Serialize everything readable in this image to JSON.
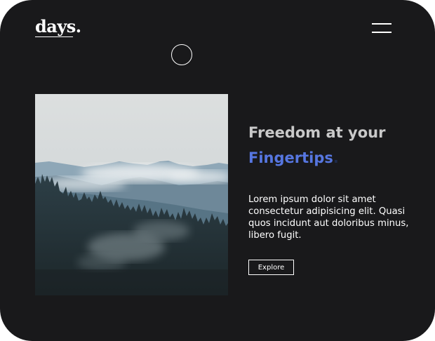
{
  "brand": {
    "logo_text": "days."
  },
  "header": {
    "menu_icon": "hamburger-menu-icon"
  },
  "hero": {
    "image_description_icon": "misty-mountain-forest-image",
    "headline_line1": "Freedom at your",
    "headline_accent": "Fingertips",
    "headline_accent_punct": ".",
    "body": "Lorem ipsum dolor sit amet consectetur adipisicing elit. Quasi quos incidunt aut doloribus minus, libero fugit.",
    "button_label": "Explore"
  },
  "colors": {
    "background": "#19191b",
    "accent": "#5676e0",
    "headline": "#c9c9c9",
    "text": "#ffffff"
  }
}
